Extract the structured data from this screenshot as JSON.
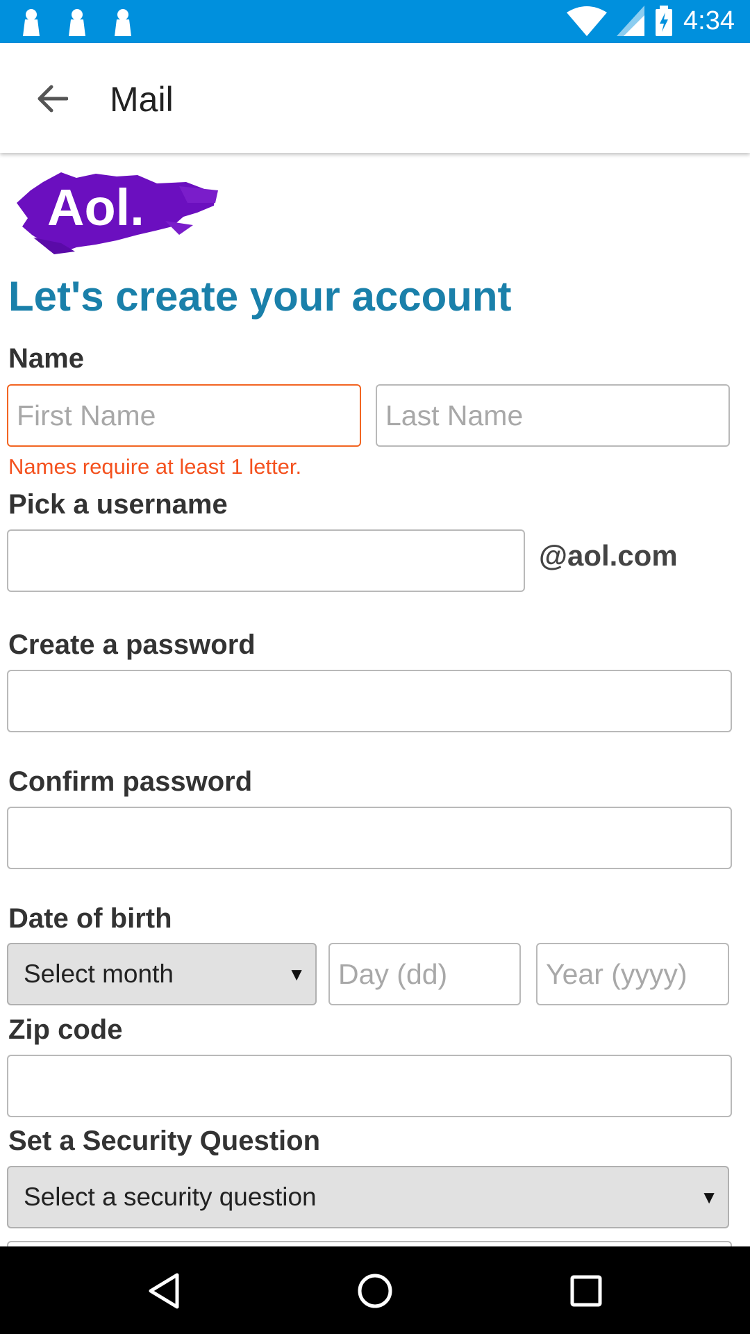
{
  "status_bar": {
    "time": "4:34",
    "icons": [
      "notification-icon",
      "notification-icon",
      "notification-icon",
      "wifi-icon",
      "signal-icon",
      "battery-charging-icon"
    ],
    "color": "#0090dd"
  },
  "app_bar": {
    "title": "Mail",
    "back_icon": "arrow-back-icon"
  },
  "logo": {
    "text": "Aol.",
    "color": "#6b0fbf"
  },
  "form": {
    "headline": "Let's create your account",
    "name_label": "Name",
    "first_name_placeholder": "First Name",
    "last_name_placeholder": "Last Name",
    "name_error": "Names require at least 1 letter.",
    "username_label": "Pick a username",
    "username_value": "",
    "domain_suffix": "@aol.com",
    "password_label": "Create a password",
    "confirm_password_label": "Confirm password",
    "dob_label": "Date of birth",
    "month_select": "Select month",
    "day_placeholder": "Day (dd)",
    "year_placeholder": "Year (yyyy)",
    "zip_label": "Zip code",
    "security_label": "Set a Security Question",
    "security_select": "Select a security question",
    "error_color": "#f4511e",
    "headline_color": "#1a80aa"
  },
  "nav_bar": {
    "icons": [
      "back-triangle-icon",
      "home-circle-icon",
      "recents-square-icon"
    ]
  }
}
